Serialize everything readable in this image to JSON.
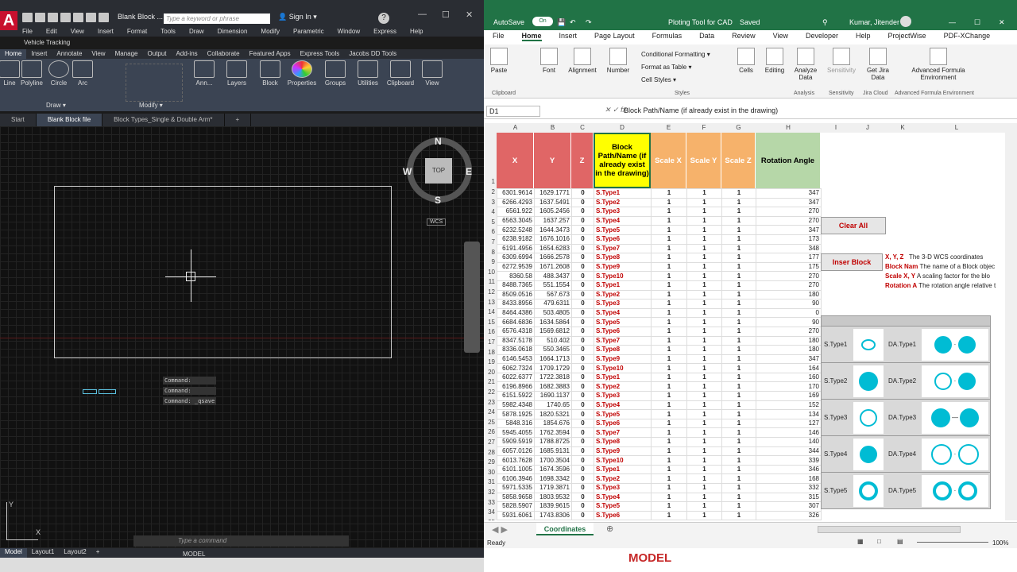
{
  "cad": {
    "doc_title": "Blank Block ...",
    "search_placeholder": "Type a keyword or phrase",
    "sign_in": "Sign In",
    "menu": [
      "File",
      "Edit",
      "View",
      "Insert",
      "Format",
      "Tools",
      "Draw",
      "Dimension",
      "Modify",
      "Parametric",
      "Window",
      "Express",
      "Help"
    ],
    "vehicle_tracking": "Vehicle Tracking",
    "ribbon_tabs": [
      "Home",
      "Insert",
      "Annotate",
      "View",
      "Manage",
      "Output",
      "Add-ins",
      "Collaborate",
      "Featured Apps",
      "Express Tools",
      "Jacobs DD Tools"
    ],
    "tools": [
      "Line",
      "Polyline",
      "Circle",
      "Arc",
      "Ann...",
      "Layers",
      "Block",
      "Properties",
      "Groups",
      "Utilities",
      "Clipboard",
      "View"
    ],
    "panel_draw": "Draw",
    "panel_modify": "Modify",
    "doc_tabs": [
      "Start",
      "Blank Block file",
      "Block Types_Single & Double Arm*"
    ],
    "viewcube": {
      "n": "N",
      "s": "S",
      "e": "E",
      "w": "W",
      "top": "TOP",
      "wcs": "WCS"
    },
    "commands": [
      "Command:",
      "Command:",
      "Command: _qsave"
    ],
    "command_placeholder": "Type a command",
    "ucs_x": "X",
    "ucs_y": "Y",
    "layout_tabs": [
      "Model",
      "Layout1",
      "Layout2"
    ],
    "model_label": "MODEL"
  },
  "excel": {
    "autosave": "AutoSave",
    "autosave_state": "On",
    "title": "Ploting Tool for CAD",
    "saved": "Saved",
    "user": "Kumar, Jitender",
    "tabs": [
      "File",
      "Home",
      "Insert",
      "Page Layout",
      "Formulas",
      "Data",
      "Review",
      "View",
      "Developer",
      "Help",
      "ProjectWise",
      "PDF-XChange"
    ],
    "ribbon": {
      "paste": "Paste",
      "font": "Font",
      "alignment": "Alignment",
      "number": "Number",
      "cond_format": "Conditional Formatting",
      "format_table": "Format as Table",
      "cell_styles": "Cell Styles",
      "cells": "Cells",
      "editing": "Editing",
      "analyze": "Analyze Data",
      "sensitivity": "Sensitivity",
      "jira": "Get Jira Data",
      "advanced": "Advanced Formula Environment",
      "g_clipboard": "Clipboard",
      "g_styles": "Styles",
      "g_analysis": "Analysis",
      "g_sensitivity": "Sensitivity",
      "g_jira": "Jira Cloud",
      "g_advanced": "Advanced Formula Environment"
    },
    "name_box": "D1",
    "formula": "Block Path/Name (if already exist in the drawing)",
    "columns": [
      "A",
      "B",
      "C",
      "D",
      "E",
      "F",
      "G",
      "H",
      "I",
      "J",
      "K",
      "L"
    ],
    "headers": {
      "x": "X",
      "y": "Y",
      "z": "Z",
      "d": "Block Path/Name (if already exist in the drawing)",
      "sx": "Scale X",
      "sy": "Scale Y",
      "sz": "Scale Z",
      "rot": "Rotation Angle"
    },
    "rows": [
      [
        "6301.9614",
        "1629.1771",
        "0",
        "S.Type1",
        "1",
        "1",
        "1",
        "347"
      ],
      [
        "6266.4293",
        "1637.5491",
        "0",
        "S.Type2",
        "1",
        "1",
        "1",
        "347"
      ],
      [
        "6561.922",
        "1605.2456",
        "0",
        "S.Type3",
        "1",
        "1",
        "1",
        "270"
      ],
      [
        "6563.3045",
        "1637.257",
        "0",
        "S.Type4",
        "1",
        "1",
        "1",
        "270"
      ],
      [
        "6232.5248",
        "1644.3473",
        "0",
        "S.Type5",
        "1",
        "1",
        "1",
        "347"
      ],
      [
        "6238.9182",
        "1676.1016",
        "0",
        "S.Type6",
        "1",
        "1",
        "1",
        "173"
      ],
      [
        "6191.4956",
        "1654.6283",
        "0",
        "S.Type7",
        "1",
        "1",
        "1",
        "348"
      ],
      [
        "6309.6994",
        "1666.2578",
        "0",
        "S.Type8",
        "1",
        "1",
        "1",
        "177"
      ],
      [
        "6272.9539",
        "1671.2608",
        "0",
        "S.Type9",
        "1",
        "1",
        "1",
        "175"
      ],
      [
        "8360.58",
        "488.3437",
        "0",
        "S.Type10",
        "1",
        "1",
        "1",
        "270"
      ],
      [
        "8488.7365",
        "551.1554",
        "0",
        "S.Type1",
        "1",
        "1",
        "1",
        "270"
      ],
      [
        "8509.0516",
        "567.673",
        "0",
        "S.Type2",
        "1",
        "1",
        "1",
        "180"
      ],
      [
        "8433.8956",
        "479.6311",
        "0",
        "S.Type3",
        "1",
        "1",
        "1",
        "90"
      ],
      [
        "8464.4386",
        "503.4805",
        "0",
        "S.Type4",
        "1",
        "1",
        "1",
        "0"
      ],
      [
        "6684.6836",
        "1634.5864",
        "0",
        "S.Type5",
        "1",
        "1",
        "1",
        "90"
      ],
      [
        "6576.4318",
        "1569.6812",
        "0",
        "S.Type6",
        "1",
        "1",
        "1",
        "270"
      ],
      [
        "8347.5178",
        "510.402",
        "0",
        "S.Type7",
        "1",
        "1",
        "1",
        "180"
      ],
      [
        "8336.0618",
        "550.3465",
        "0",
        "S.Type8",
        "1",
        "1",
        "1",
        "180"
      ],
      [
        "6146.5453",
        "1664.1713",
        "0",
        "S.Type9",
        "1",
        "1",
        "1",
        "347"
      ],
      [
        "6062.7324",
        "1709.1729",
        "0",
        "S.Type10",
        "1",
        "1",
        "1",
        "164"
      ],
      [
        "6022.6377",
        "1722.3818",
        "0",
        "S.Type1",
        "1",
        "1",
        "1",
        "160"
      ],
      [
        "6196.8966",
        "1682.3883",
        "0",
        "S.Type2",
        "1",
        "1",
        "1",
        "170"
      ],
      [
        "6151.5922",
        "1690.1137",
        "0",
        "S.Type3",
        "1",
        "1",
        "1",
        "169"
      ],
      [
        "5982.4348",
        "1740.65",
        "0",
        "S.Type4",
        "1",
        "1",
        "1",
        "152"
      ],
      [
        "5878.1925",
        "1820.5321",
        "0",
        "S.Type5",
        "1",
        "1",
        "1",
        "134"
      ],
      [
        "5848.316",
        "1854.676",
        "0",
        "S.Type6",
        "1",
        "1",
        "1",
        "127"
      ],
      [
        "5945.4055",
        "1762.3594",
        "0",
        "S.Type7",
        "1",
        "1",
        "1",
        "146"
      ],
      [
        "5909.5919",
        "1788.8725",
        "0",
        "S.Type8",
        "1",
        "1",
        "1",
        "140"
      ],
      [
        "6057.0126",
        "1685.9131",
        "0",
        "S.Type9",
        "1",
        "1",
        "1",
        "344"
      ],
      [
        "6013.7628",
        "1700.3504",
        "0",
        "S.Type10",
        "1",
        "1",
        "1",
        "339"
      ],
      [
        "6101.1005",
        "1674.3596",
        "0",
        "S.Type1",
        "1",
        "1",
        "1",
        "346"
      ],
      [
        "6106.3946",
        "1698.3342",
        "0",
        "S.Type2",
        "1",
        "1",
        "1",
        "168"
      ],
      [
        "5971.5335",
        "1719.3871",
        "0",
        "S.Type3",
        "1",
        "1",
        "1",
        "332"
      ],
      [
        "5858.9658",
        "1803.9532",
        "0",
        "S.Type4",
        "1",
        "1",
        "1",
        "315"
      ],
      [
        "5828.5907",
        "1839.9615",
        "0",
        "S.Type5",
        "1",
        "1",
        "1",
        "307"
      ],
      [
        "5931.6061",
        "1743.8306",
        "0",
        "S.Type6",
        "1",
        "1",
        "1",
        "326"
      ]
    ],
    "clear_all": "Clear All",
    "insert_block": "Inser Block",
    "legend": [
      {
        "k": "X, Y, Z",
        "v": "The 3-D WCS coordinates"
      },
      {
        "k": "Block Nam",
        "v": "The name of a Block objec"
      },
      {
        "k": "Scale X, Y",
        "v": "A scaling factor for the blo"
      },
      {
        "k": "Rotation A",
        "v": "The rotation angle relative t"
      }
    ],
    "symbols": [
      {
        "s": "S.Type1",
        "d": "DA.Type1"
      },
      {
        "s": "S.Type2",
        "d": "DA.Type2"
      },
      {
        "s": "S.Type3",
        "d": "DA.Type3"
      },
      {
        "s": "S.Type4",
        "d": "DA.Type4"
      },
      {
        "s": "S.Type5",
        "d": "DA.Type5"
      }
    ],
    "sheet_tab": "Coordinates",
    "status": "Ready",
    "zoom": "100%",
    "bottom_text": "MODEL"
  },
  "colors": {
    "red_header": "#e06666",
    "yellow_header": "#ffff00",
    "orange_header": "#f6b26b",
    "green_header": "#b6d7a8",
    "excel_green": "#217346",
    "cyan": "#00bcd4"
  }
}
